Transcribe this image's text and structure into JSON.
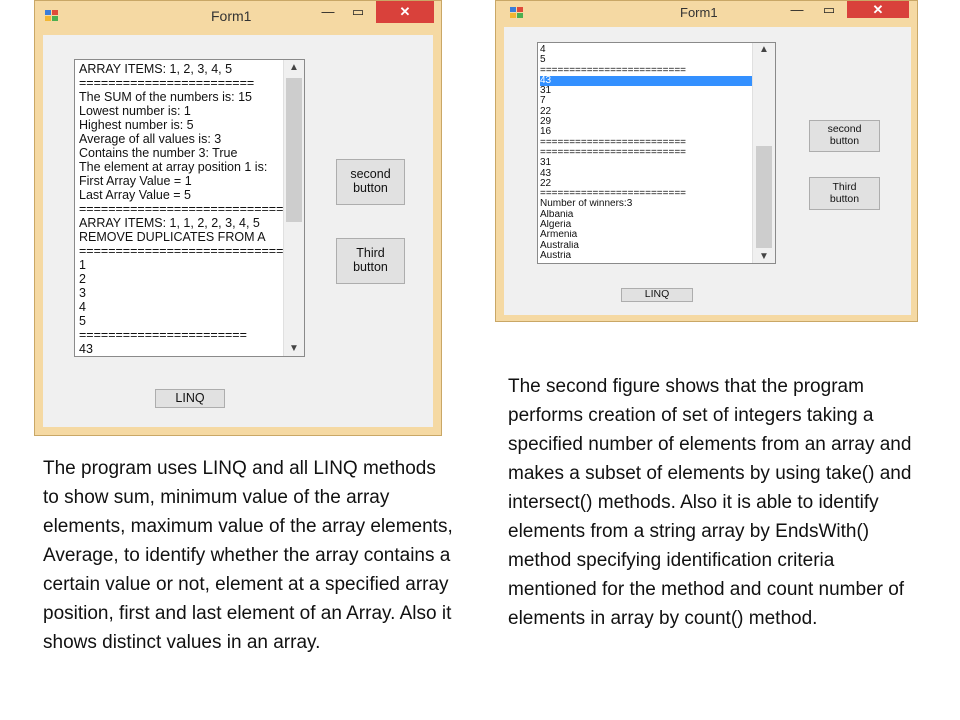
{
  "window1": {
    "title": "Form1",
    "min_glyph": "—",
    "max_glyph": "▭",
    "close_glyph": "✕",
    "listbox_items": [
      "ARRAY ITEMS: 1, 2, 3, 4, 5",
      "========================",
      "The SUM of the numbers is: 15",
      "Lowest number is: 1",
      "Highest number is: 5",
      "Average of all values is: 3",
      "Contains the number 3: True",
      "The element at array position 1 is:",
      "First Array Value = 1",
      "Last Array Value = 5",
      "==============================",
      "ARRAY ITEMS: 1, 1, 2, 2, 3, 4, 5",
      "REMOVE DUPLICATES FROM A",
      "==============================",
      "1",
      "2",
      "3",
      "4",
      "5",
      "=======================",
      "43"
    ],
    "second_button": "second\nbutton",
    "third_button": "Third\nbutton",
    "linq_button": "LINQ"
  },
  "window2": {
    "title": "Form1",
    "min_glyph": "—",
    "max_glyph": "▭",
    "close_glyph": "✕",
    "selected_index": 3,
    "listbox_items": [
      "4",
      "5",
      "=========================",
      "43",
      "31",
      "7",
      "22",
      "29",
      "16",
      "=========================",
      "=========================",
      "31",
      "43",
      "22",
      "=========================",
      "Number of winners:3",
      "Albania",
      "Algeria",
      "Armenia",
      "Australia",
      "Austria"
    ],
    "second_button": "second\nbutton",
    "third_button": "Third\nbutton",
    "linq_button": "LINQ"
  },
  "captions": {
    "left": "The program uses LINQ and all LINQ methods to show sum, minimum value of the array elements, maximum value of the array elements, Average, to identify whether the array contains a certain value or not, element at a specified array position, first and last element of an Array.  Also it  shows distinct values in an array.",
    "right": "The second figure shows that the program performs  creation of set of integers taking a specified number of elements from an array and makes a subset of elements by using take() and intersect() methods. Also it is able to identify elements from a string array by EndsWith() method specifying identification criteria mentioned for the method and count number of elements in array by count() method."
  },
  "colors": {
    "frame": "#f5d9a3",
    "client": "#f0f0f0",
    "close_button": "#d9413b",
    "selection": "#3390ff"
  },
  "icons": [
    "app-icon",
    "minimize-icon",
    "maximize-icon",
    "close-icon",
    "scroll-up-arrow-icon",
    "scroll-down-arrow-icon"
  ]
}
